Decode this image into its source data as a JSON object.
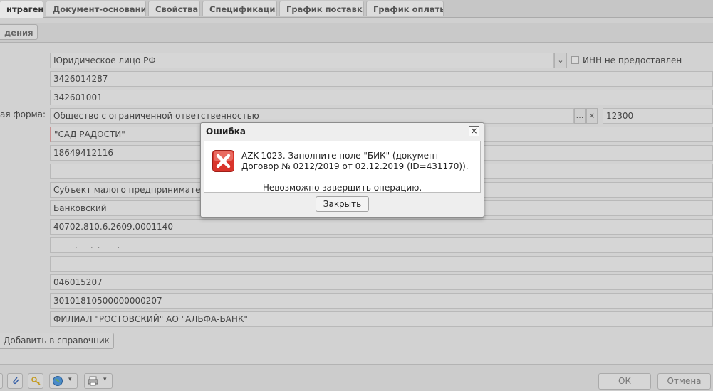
{
  "tabs": [
    {
      "label": "нтрагент",
      "active": true
    },
    {
      "label": "Документ-основание"
    },
    {
      "label": "Свойства"
    },
    {
      "label": "Спецификация"
    },
    {
      "label": "График поставки"
    },
    {
      "label": "График оплаты"
    }
  ],
  "subtab": {
    "label": "дения"
  },
  "form": {
    "entity_type": "Юридическое лицо РФ",
    "inn_checkbox_label": "ИНН не предоставлен",
    "inn": "3426014287",
    "kpp": "342601001",
    "legal_form_label": "ая форма:",
    "legal_form": "Общество с ограниченной ответственностью",
    "legal_form_code": "12300",
    "name": "\"САД РАДОСТИ\"",
    "phone": "18649412116",
    "empty_1": "",
    "business_category": "Субъект малого предпринимательства",
    "account_type": "Банковский",
    "account_number": "40702.810.6.2609.0001140",
    "account_mask": "_____.___._.____.______",
    "empty_2": "",
    "bik": "046015207",
    "corr_account": "30101810500000000207",
    "bank_name": "ФИЛИАЛ \"РОСТОВСКИЙ\" АО \"АЛЬФА-БАНК\""
  },
  "add_button": {
    "label": "Добавить в справочник"
  },
  "footer": {
    "ok_label": "ОК",
    "cancel_label": "Отмена"
  },
  "dialog": {
    "title": "Ошибка",
    "message": "AZK-1023. Заполните поле \"БИК\" (документ Договор № 0212/2019 от 02.12.2019 (ID=431170)).",
    "message2": "Невозможно завершить операцию.",
    "button_label": "Закрыть",
    "icon": "error-icon"
  },
  "colors": {
    "error_red": "#d9342b"
  }
}
